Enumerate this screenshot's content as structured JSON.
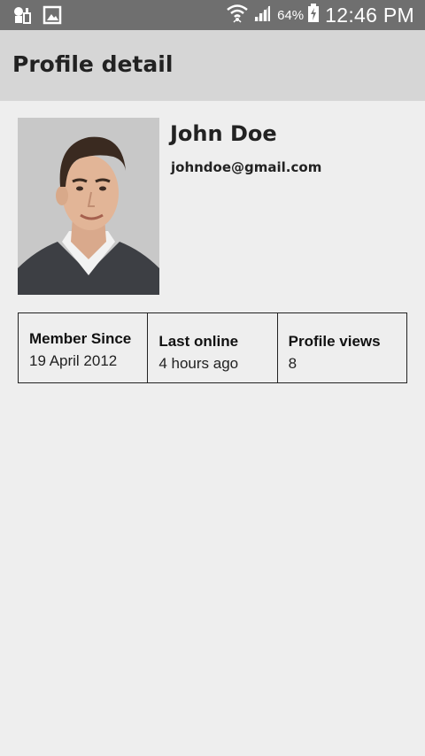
{
  "status_bar": {
    "battery_percent": "64%",
    "time": "12:46 PM",
    "icons": [
      "notification-icon",
      "gallery-icon",
      "wifi-icon",
      "signal-icon",
      "battery-icon"
    ]
  },
  "app_bar": {
    "title": "Profile detail"
  },
  "profile": {
    "name": "John Doe",
    "email": "johndoe@gmail.com"
  },
  "stats": [
    {
      "label": "Member Since",
      "value": "19 April 2012"
    },
    {
      "label": "Last online",
      "value": "4 hours ago"
    },
    {
      "label": "Profile views",
      "value": "8"
    }
  ],
  "colors": {
    "status_bar": "#6f6f6f",
    "app_bar": "#d6d6d6",
    "background": "#eeeeee",
    "text": "#222222"
  }
}
